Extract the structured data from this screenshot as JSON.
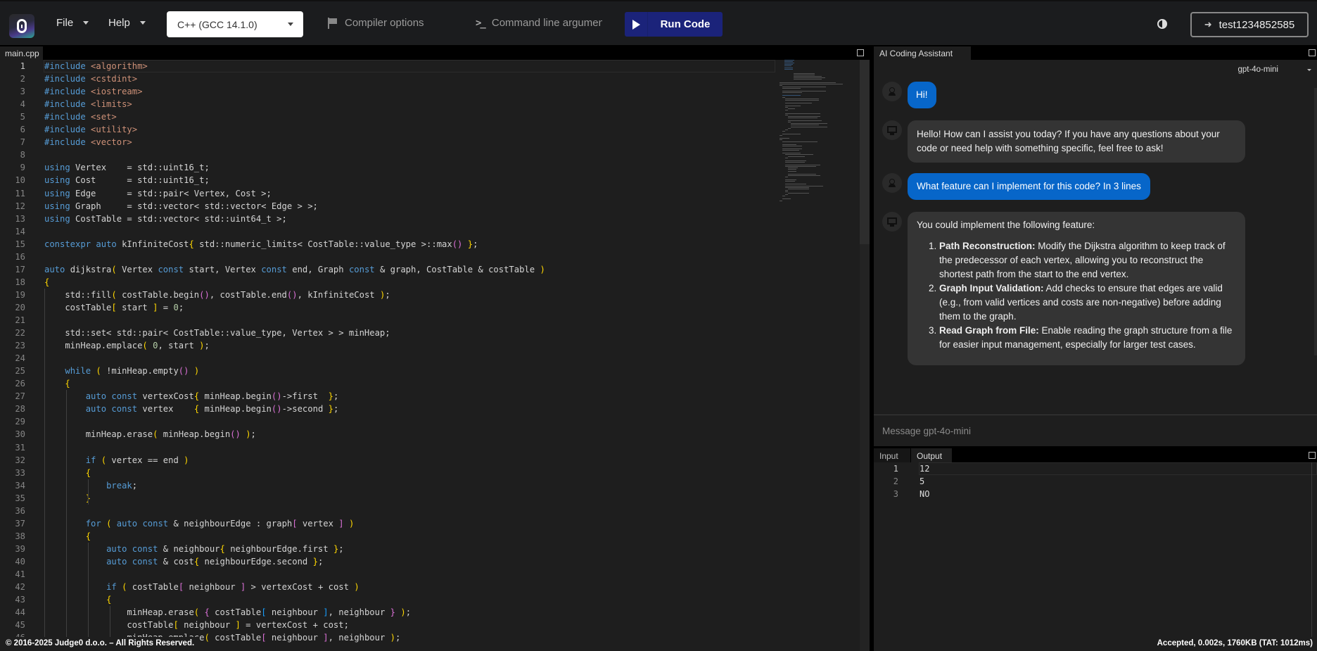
{
  "header": {
    "logo": "Judge0 logo",
    "menus": [
      {
        "label": "File"
      },
      {
        "label": "Help"
      }
    ],
    "language_select": "C++ (GCC 14.1.0)",
    "compiler_options_label": "Compiler options",
    "command_line_args_label": "Command line arguments",
    "run_button_label": "Run Code",
    "theme_toggle_icon": "contrast-icon",
    "user_button_label": "test1234852585",
    "colors": {
      "run_button": "#1b237a",
      "user_bubble": "#0766c9"
    }
  },
  "editor": {
    "tab_label": "main.cpp",
    "active_line": 1,
    "lines": [
      "#include <algorithm>",
      "#include <cstdint>",
      "#include <iostream>",
      "#include <limits>",
      "#include <set>",
      "#include <utility>",
      "#include <vector>",
      "",
      "using Vertex    = std::uint16_t;",
      "using Cost      = std::uint16_t;",
      "using Edge      = std::pair< Vertex, Cost >;",
      "using Graph     = std::vector< std::vector< Edge > >;",
      "using CostTable = std::vector< std::uint64_t >;",
      "",
      "constexpr auto kInfiniteCost{ std::numeric_limits< CostTable::value_type >::max() };",
      "",
      "auto dijkstra( Vertex const start, Vertex const end, Graph const & graph, CostTable & costTable )",
      "{",
      "    std::fill( costTable.begin(), costTable.end(), kInfiniteCost );",
      "    costTable[ start ] = 0;",
      "",
      "    std::set< std::pair< CostTable::value_type, Vertex > > minHeap;",
      "    minHeap.emplace( 0, start );",
      "",
      "    while ( !minHeap.empty() )",
      "    {",
      "        auto const vertexCost{ minHeap.begin()->first  };",
      "        auto const vertex    { minHeap.begin()->second };",
      "",
      "        minHeap.erase( minHeap.begin() );",
      "",
      "        if ( vertex == end )",
      "        {",
      "            break;",
      "        }",
      "",
      "        for ( auto const & neighbourEdge : graph[ vertex ] )",
      "        {",
      "            auto const & neighbour{ neighbourEdge.first };",
      "            auto const & cost{ neighbourEdge.second };",
      "",
      "            if ( costTable[ neighbour ] > vertexCost + cost )",
      "            {",
      "                minHeap.erase( { costTable[ neighbour ], neighbour } );",
      "                costTable[ neighbour ] = vertexCost + cost;",
      "                minHeap.emplace( costTable[ neighbour ], neighbour );"
    ]
  },
  "assistant": {
    "tab_label": "AI Coding Assistant",
    "model": "gpt-4o-mini",
    "messages": [
      {
        "role": "user",
        "text": "Hi!"
      },
      {
        "role": "assistant",
        "text": "Hello! How can I assist you today? If you have any questions about your code or need help with something specific, feel free to ask!"
      },
      {
        "role": "user",
        "text": "What feature can I implement for this code? In 3 lines"
      },
      {
        "role": "assistant",
        "intro": "You could implement the following feature:",
        "items": [
          {
            "title": "Path Reconstruction:",
            "text": " Modify the Dijkstra algorithm to keep track of the predecessor of each vertex, allowing you to reconstruct the shortest path from the start to the end vertex."
          },
          {
            "title": "Graph Input Validation:",
            "text": " Add checks to ensure that edges are valid (e.g., from valid vertices and costs are non-negative) before adding them to the graph."
          },
          {
            "title": "Read Graph from File:",
            "text": " Enable reading the graph structure from a file for easier input management, especially for larger test cases."
          }
        ]
      }
    ],
    "input_placeholder": "Message gpt-4o-mini",
    "input_value": ""
  },
  "io": {
    "tabs": [
      {
        "label": "Input"
      },
      {
        "label": "Output"
      }
    ],
    "active_tab": "Output",
    "output_lines": [
      "12",
      "5",
      "NO"
    ]
  },
  "footer": {
    "copyright": "© 2016-2025 Judge0 d.o.o. – All Rights Reserved.",
    "status": "Accepted, 0.002s, 1760KB (TAT: 1012ms)"
  }
}
